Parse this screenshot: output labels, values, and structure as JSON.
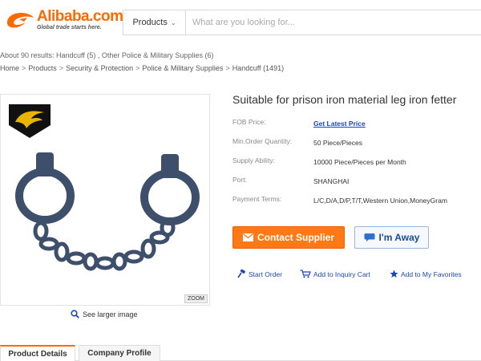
{
  "header": {
    "logo_text": "Alibaba.com",
    "logo_tagline": "Global trade starts here.",
    "search_category": "Products",
    "search_placeholder": "What are you looking for..."
  },
  "results_text": "About 90 results:  Handcuff (5) , Other Police & Military Supplies (6)",
  "breadcrumb": [
    "Home",
    "Products",
    "Security & Protection",
    "Police & Military Supplies",
    "Handcuff (1491)"
  ],
  "gallery": {
    "zoom_label": "ZOOM",
    "larger_label": "See larger image"
  },
  "product": {
    "title": "Suitable for prison iron material leg iron fetter",
    "specs": [
      {
        "label": "FOB Price:",
        "value": "Get Latest Price",
        "link": true
      },
      {
        "label": "Min.Order Quantity:",
        "value": "50 Piece/Pieces",
        "link": false
      },
      {
        "label": "Supply Ability:",
        "value": "10000 Piece/Pieces per Month",
        "link": false
      },
      {
        "label": "Port:",
        "value": "SHANGHAI",
        "link": false
      },
      {
        "label": "Payment Terms:",
        "value": "L/C,D/A,D/P,T/T,Western Union,MoneyGram",
        "link": false
      }
    ],
    "contact_label": "Contact Supplier",
    "away_label": "I'm Away",
    "actions": {
      "start_order": "Start Order",
      "inquiry_cart": "Add to Inquiry Cart",
      "favorites": "Add to My Favorites"
    }
  },
  "tabs": [
    "Product Details",
    "Company Profile"
  ],
  "colors": {
    "brand": "#ff6a00",
    "contact_button": "#ff7a14",
    "link": "#1a47b8",
    "handcuff_steel": "#3d4f6a"
  }
}
